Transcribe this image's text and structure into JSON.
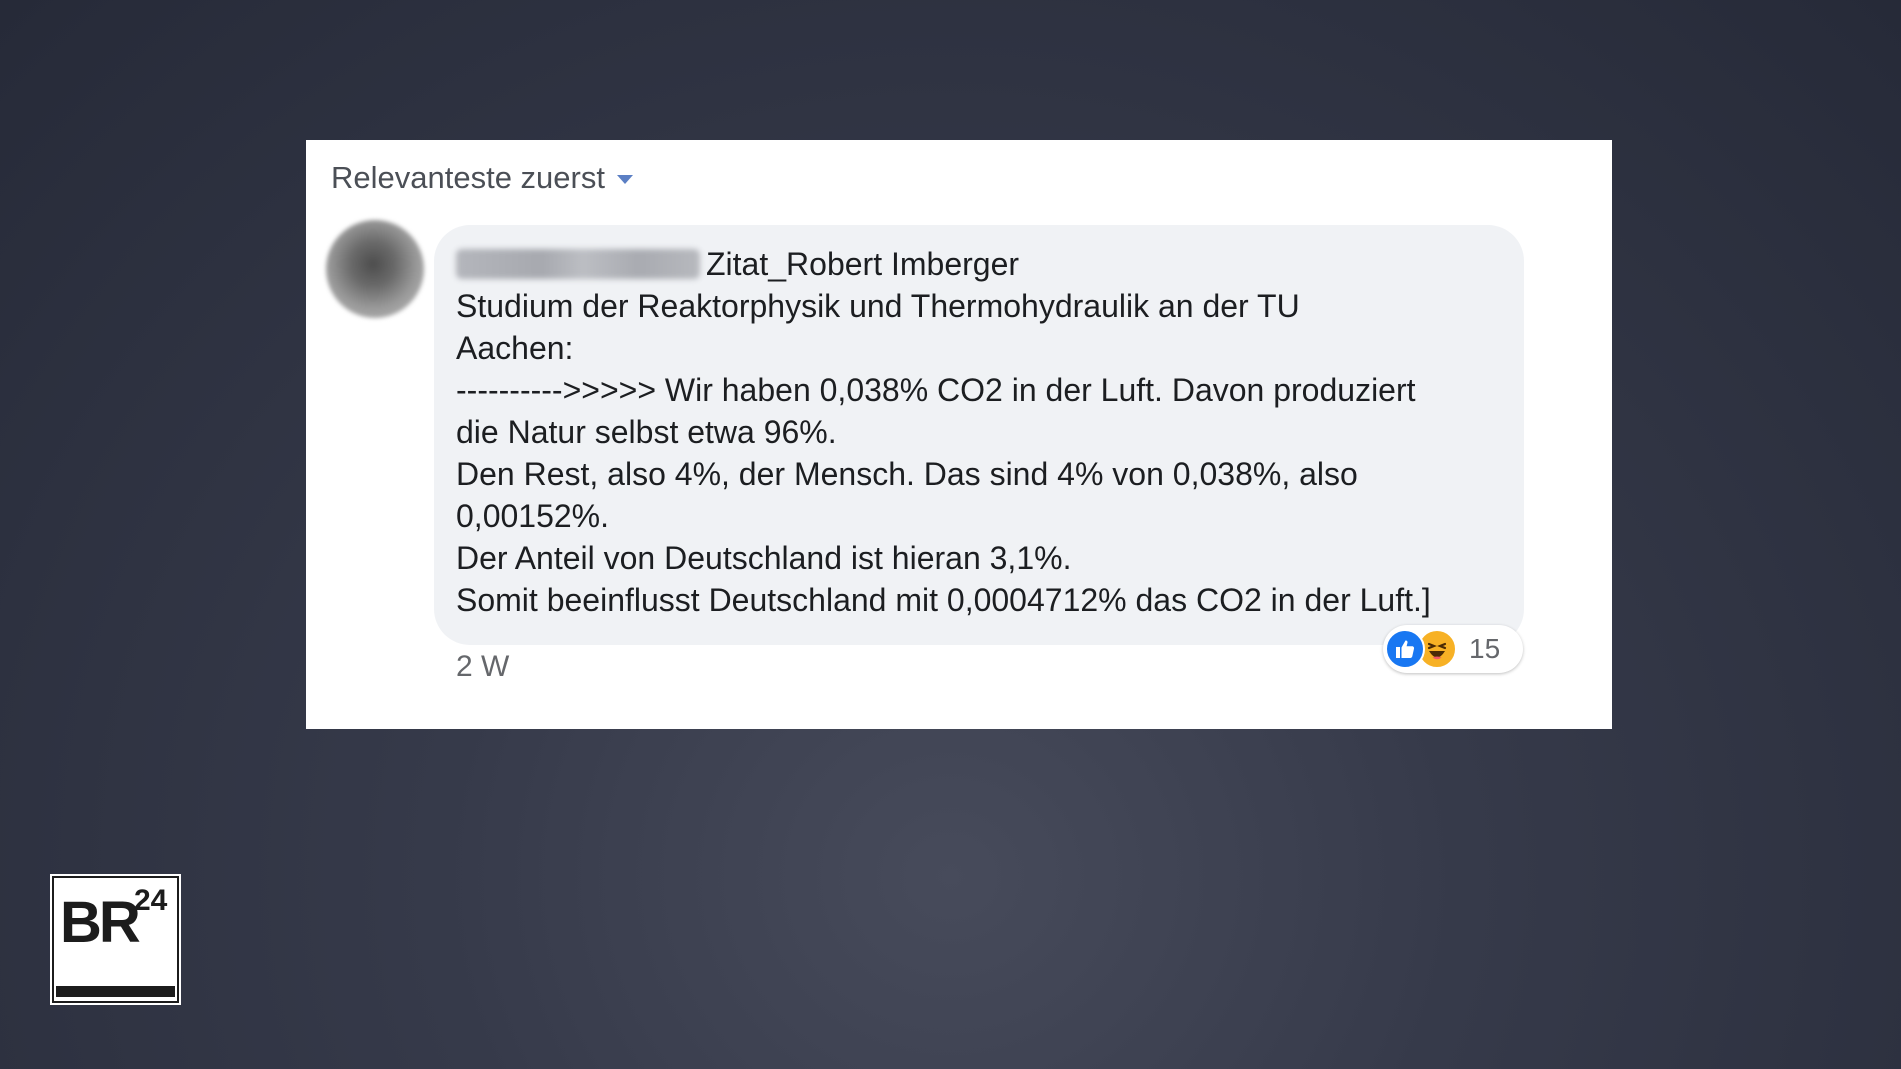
{
  "sort": {
    "label": "Relevanteste zuerst"
  },
  "comment": {
    "quote_label": "Zitat_Robert Imberger",
    "lines": [
      "Studium der Reaktorphysik und Thermohydraulik an der TU",
      "Aachen:",
      "---------->>>>> Wir haben 0,038% CO2 in der Luft. Davon produziert",
      "die Natur selbst etwa 96%.",
      "Den Rest, also 4%, der Mensch. Das sind 4% von 0,038%, also",
      "0,00152%.",
      "Der Anteil von Deutschland ist hieran 3,1%.",
      "Somit beeinflusst Deutschland mit 0,0004712% das CO2 in der Luft.]"
    ],
    "timestamp": "2 W",
    "reactions": {
      "icons": [
        "like-icon",
        "haha-icon"
      ],
      "count": "15"
    }
  },
  "logo": {
    "text": "BR24"
  },
  "colors": {
    "like_blue": "#1877f2",
    "haha_yellow": "#f7b125",
    "bubble_bg": "#f0f2f5",
    "caret_blue": "#5b7fc4"
  }
}
